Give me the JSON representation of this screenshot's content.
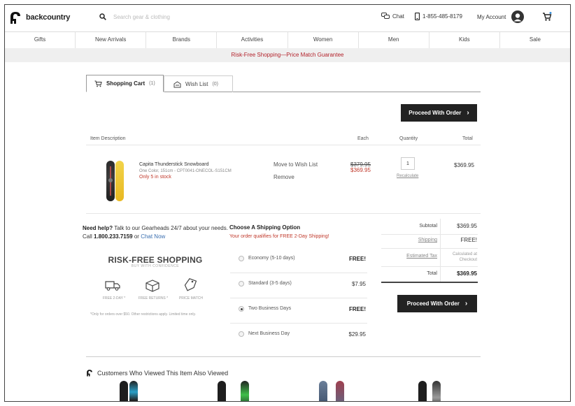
{
  "header": {
    "logo_text": "backcountry",
    "search_placeholder": "Search gear & clothing",
    "chat_label": "Chat",
    "phone": "1-855-485-8179",
    "account_label": "My Account"
  },
  "nav": [
    "Gifts",
    "New Arrivals",
    "Brands",
    "Activities",
    "Women",
    "Men",
    "Kids",
    "Sale"
  ],
  "promo": "Risk-Free Shopping—Price Match Guarantee",
  "tabs": {
    "cart_label": "Shopping Cart",
    "cart_count": "(1)",
    "wish_label": "Wish List",
    "wish_count": "(0)"
  },
  "proceed_label": "Proceed With Order",
  "table_headers": {
    "item": "Item Description",
    "each": "Each",
    "quantity": "Quantity",
    "total": "Total"
  },
  "item": {
    "name": "Capita  Thunderstick Snowboard",
    "sku": "One Color, 151cm - CPT0041-ONECOL-S151CM",
    "stock": "Only  5 in stock",
    "move_to_wishlist": "Move to Wish List",
    "remove": "Remove",
    "old_price": "$379.95",
    "price": "$369.95",
    "quantity": "1",
    "recalculate": "Recalculate",
    "total": "$369.95"
  },
  "help": {
    "lead": "Need help?",
    "text": " Talk to our Gearheads 24/7 about your needs.",
    "call": "Call ",
    "phone": "1.800.233.7159",
    "or": " or ",
    "chat": "Chat Now"
  },
  "risk_free": {
    "title": "RISK-FREE SHOPPING",
    "subtitle": "BUY WITH CONFIDENCE",
    "labels": [
      "FREE 2-DAY *",
      "FREE RETURNS *",
      "PRICE MATCH"
    ],
    "note": "*Only for orders over $50. Other restrictions apply. Limited time only."
  },
  "shipping": {
    "title": "Choose A Shipping Option",
    "subtitle": "Your order qualifies for FREE 2-Day Shipping!",
    "options": [
      {
        "label": "Economy (5-10 days)",
        "price": "FREE!",
        "selected": false
      },
      {
        "label": "Standard (3-5 days)",
        "price": "$7.95",
        "selected": false
      },
      {
        "label": "Two Business Days",
        "price": "FREE!",
        "selected": true
      },
      {
        "label": "Next Business Day",
        "price": "$29.95",
        "selected": false
      }
    ]
  },
  "summary": {
    "subtotal_label": "Subtotal",
    "subtotal": "$369.95",
    "shipping_label": "Shipping",
    "shipping": "FREE!",
    "tax_label": "Estimated Tax",
    "tax": "Calculated at Checkout",
    "total_label": "Total",
    "total": "$369.95"
  },
  "also_viewed": "Customers Who Viewed This Item Also Viewed",
  "colors": {
    "accent_red": "#b3222b",
    "button_dark": "#222222",
    "link_blue": "#3a6fb0"
  }
}
